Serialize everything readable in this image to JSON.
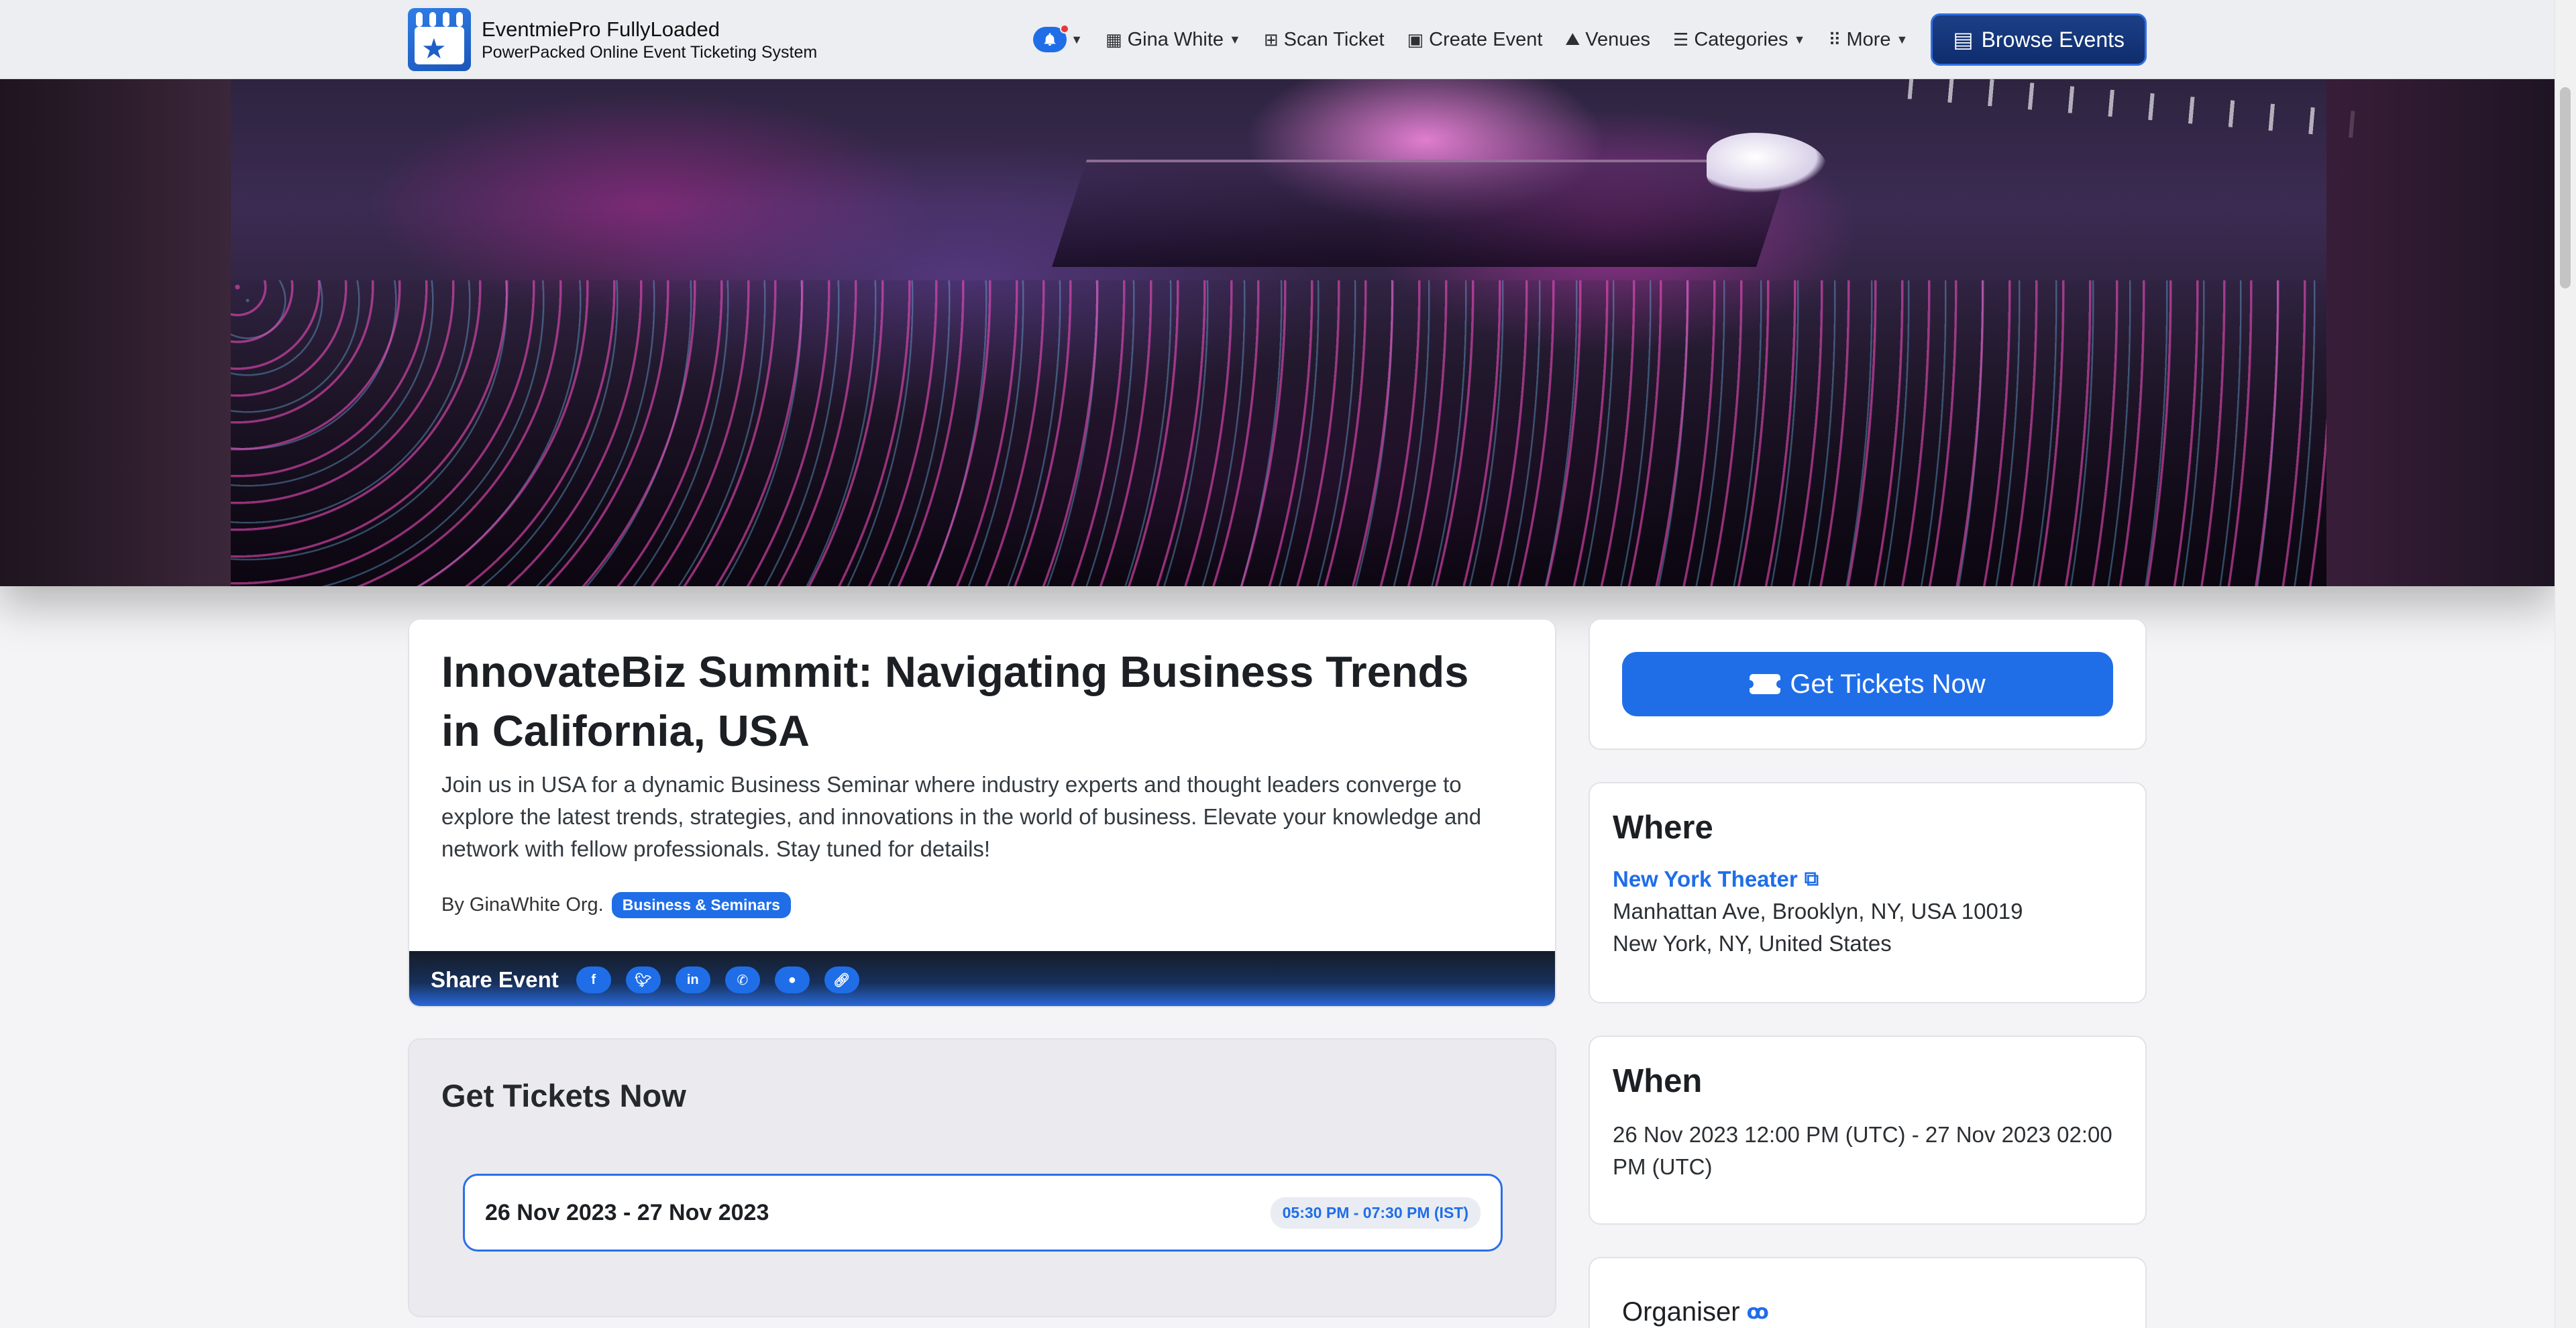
{
  "navbar": {
    "brand_title": "EventmiePro FullyLoaded",
    "brand_subtitle": "PowerPacked Online Event Ticketing System",
    "notifications_icon": "bell-icon",
    "user_name": "Gina White",
    "scan_ticket": "Scan Ticket",
    "create_event": "Create Event",
    "venues": "Venues",
    "categories": "Categories",
    "more": "More",
    "browse_events": "Browse Events"
  },
  "event": {
    "title": "InnovateBiz Summit: Navigating Business Trends in California, USA",
    "description": "Join us in USA for a dynamic Business Seminar where industry experts and thought leaders converge to explore the latest trends, strategies, and innovations in the world of business. Elevate your knowledge and network with fellow professionals. Stay tuned for details!",
    "organizer_byline": "By GinaWhite Org.",
    "category_badge": "Business & Seminars",
    "share_label": "Share Event",
    "share_buttons": [
      "facebook",
      "twitter",
      "linkedin",
      "whatsapp",
      "reddit",
      "copy-link"
    ]
  },
  "tickets": {
    "title": "Get Tickets Now",
    "date_range": "26 Nov 2023 - 27 Nov 2023",
    "time_pill": "05:30 PM - 07:30 PM (IST)"
  },
  "sidebar": {
    "get_tickets_button": "Get Tickets Now",
    "where_heading": "Where",
    "venue_name": "New York Theater",
    "address_line1": "Manhattan Ave, Brooklyn, NY, USA 10019",
    "address_line2": "New York, NY, United States",
    "when_heading": "When",
    "when_text": "26 Nov 2023 12:00 PM (UTC) - 27 Nov 2023 02:00 PM (UTC)",
    "organiser_heading": "Organiser"
  },
  "colors": {
    "primary": "#1f6ee8",
    "browse_button_bg": "#0f2d6e",
    "notification_dot": "#e53935"
  }
}
